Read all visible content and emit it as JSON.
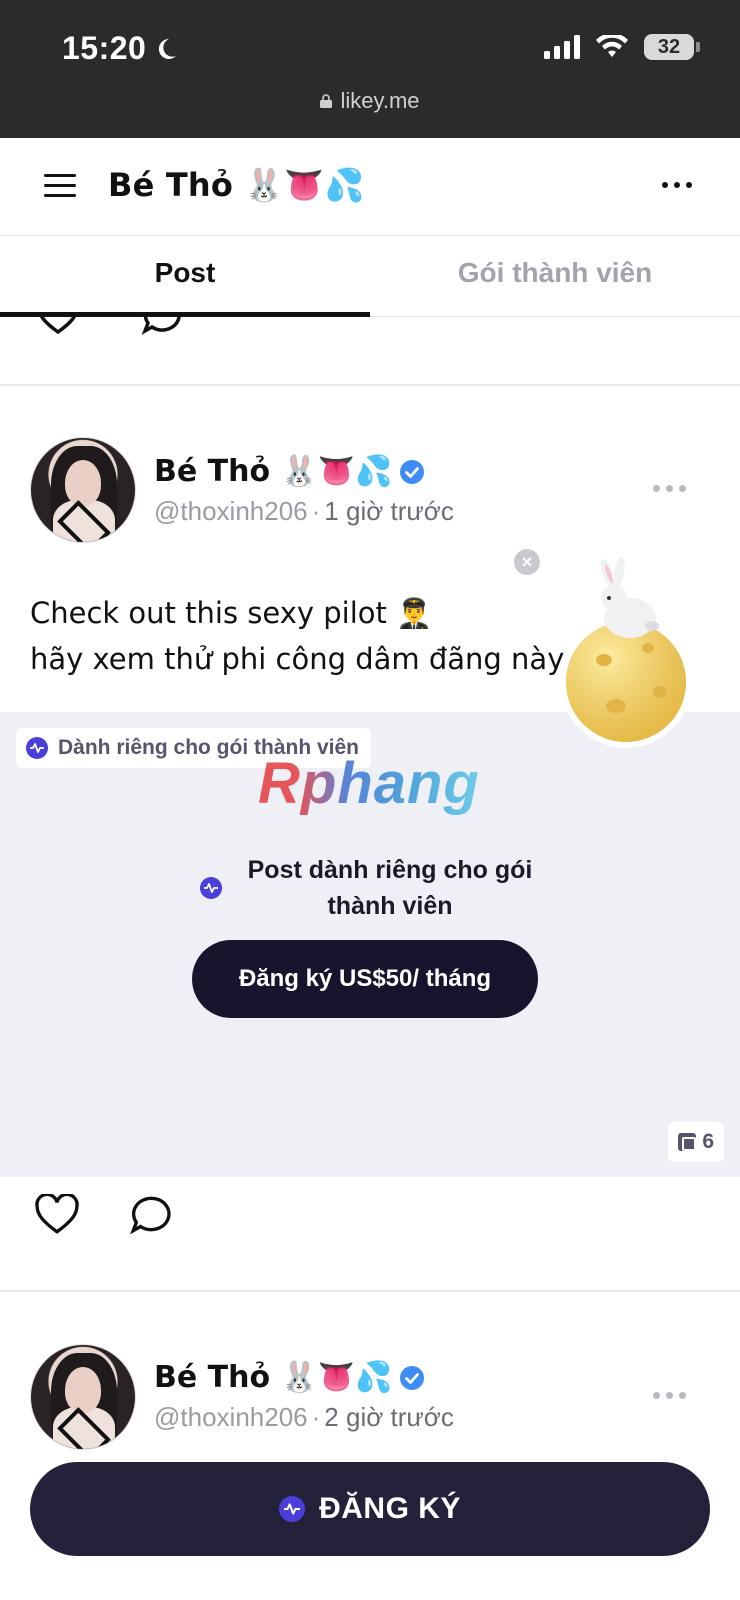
{
  "status": {
    "time": "15:20",
    "battery": "32",
    "url": "likey.me"
  },
  "header": {
    "title": "Bé Thỏ 🐰👅💦"
  },
  "tabs": [
    {
      "label": "Post",
      "active": true
    },
    {
      "label": "Gói thành viên",
      "active": false
    }
  ],
  "posts": [
    {
      "author": "Bé Thỏ 🐰👅💦",
      "handle": "@thoxinh206",
      "separator": "·",
      "time_ago": "1 giờ trước",
      "text_line1": "Check out this sexy pilot 👨‍✈️",
      "text_line2": "hãy xem thử phi công dâm đãng này 👋🏻",
      "members_badge": "Dành riêng cho gói thành viên",
      "watermark": "Rphang",
      "locked_message": "Post dành riêng cho gói thành viên",
      "subscribe_button": "Đăng ký US$50/ tháng",
      "media_count": "6"
    },
    {
      "author": "Bé Thỏ 🐰👅💦",
      "handle": "@thoxinh206",
      "separator": "·",
      "time_ago": "2 giờ trước"
    }
  ],
  "bottom_cta": {
    "label": "ĐĂNG KÝ"
  },
  "colors": {
    "status_bg": "#2b2b2d",
    "locked_bg": "#efeff6",
    "cta_dark": "#17152e",
    "bottom_cta_bg": "#23223a",
    "verified_blue": "#3d8df5",
    "brand_purple": "#4b3fd9"
  },
  "icons": [
    "moon-icon",
    "signal-icon",
    "wifi-icon",
    "lock-icon",
    "hamburger-icon",
    "more-icon",
    "verified-icon",
    "heart-icon",
    "comment-icon",
    "pulse-icon",
    "media-stack-icon",
    "close-icon",
    "moon-rabbit-sticker"
  ]
}
